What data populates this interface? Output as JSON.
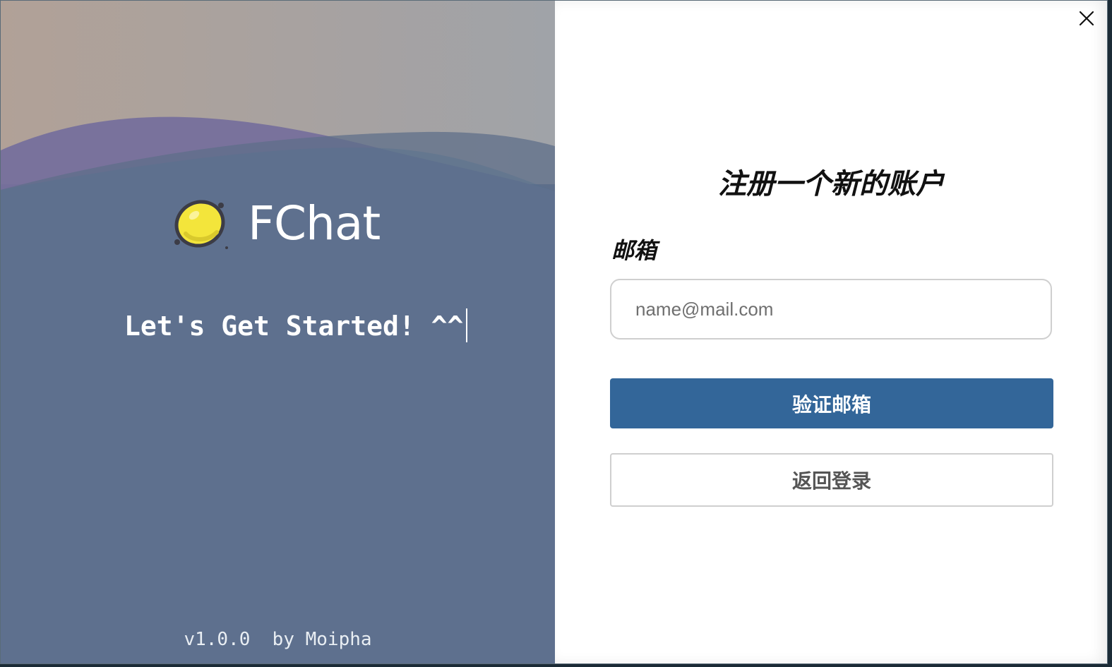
{
  "brand": {
    "name": "FChat",
    "logo_icon": "lemon-icon",
    "tagline": "Let's Get Started! ^^"
  },
  "footer": {
    "text": "v1.0.0  by Moipha"
  },
  "form": {
    "title": "注册一个新的账户",
    "email_label": "邮箱",
    "email_placeholder": "name@mail.com",
    "email_value": "",
    "verify_button": "验证邮箱",
    "back_button": "返回登录"
  },
  "window": {
    "close_icon": "close-icon"
  },
  "colors": {
    "primary": "#336699",
    "lemon": "#f5e23a",
    "panel_gradient_start": "#7a6a86",
    "panel_gradient_end": "#45709a"
  }
}
